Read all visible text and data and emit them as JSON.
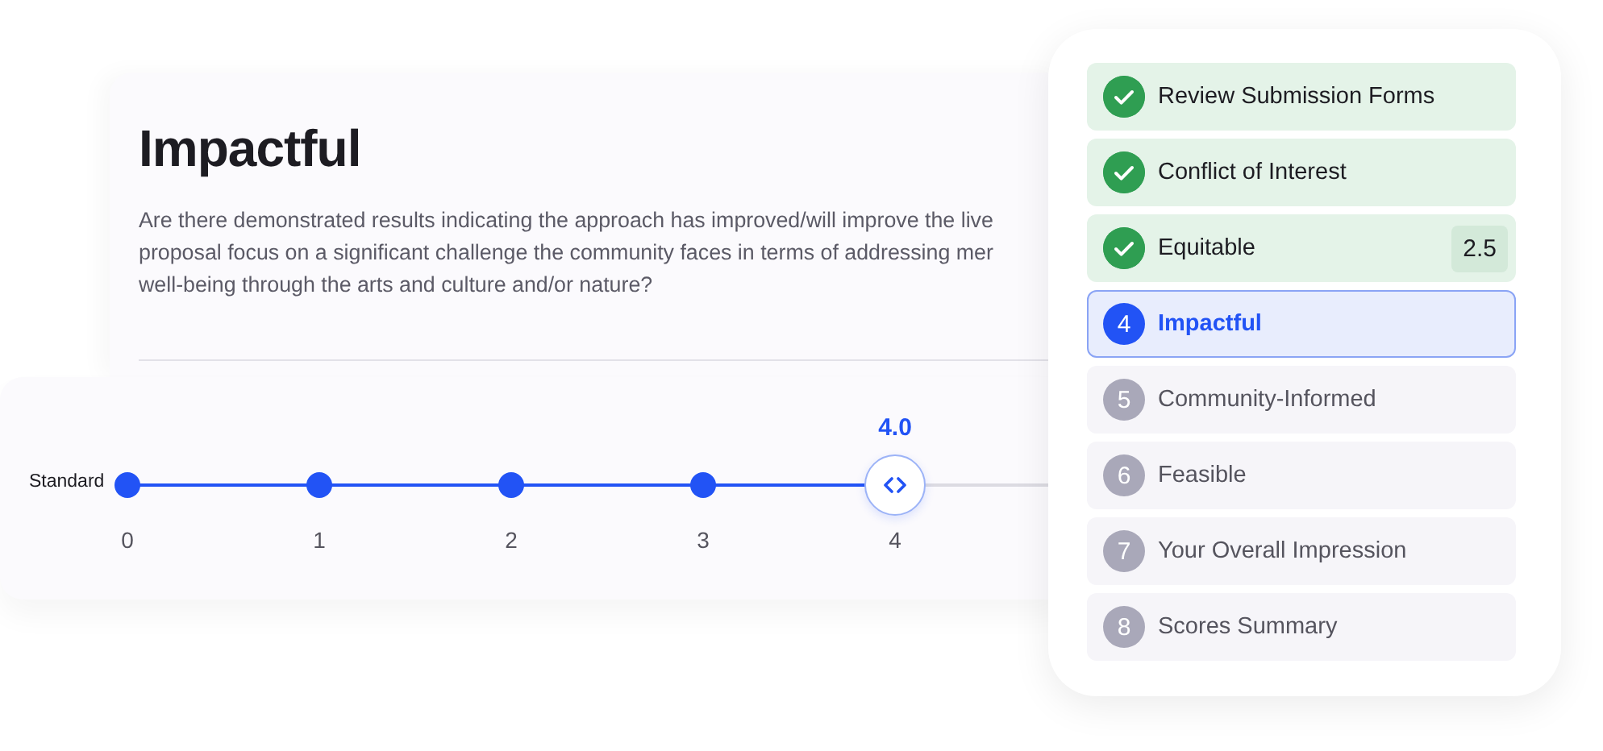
{
  "criterion": {
    "title": "Impactful",
    "description_lines": [
      "Are there demonstrated results indicating the approach has improved/will improve the live",
      "proposal focus on a significant challenge the community faces in terms of addressing mer",
      "well-being through the arts and culture and/or nature?"
    ]
  },
  "rating": {
    "label": "Standard",
    "value": "4.0",
    "level": 0.8,
    "ticks": [
      "0",
      "1",
      "2",
      "3",
      "4"
    ]
  },
  "steps": [
    {
      "label": "Review Submission Forms",
      "completed": true,
      "selected": false
    },
    {
      "label": "Conflict of Interest",
      "completed": true,
      "selected": false
    },
    {
      "label": "Equitable",
      "completed": true,
      "selected": false,
      "score": "2.5"
    },
    {
      "number": "4",
      "label": "Impactful",
      "completed": false,
      "selected": true
    },
    {
      "number": "5",
      "label": "Community-Informed",
      "completed": false,
      "selected": false
    },
    {
      "number": "6",
      "label": "Feasible",
      "completed": false,
      "selected": false
    },
    {
      "number": "7",
      "label": "Your Overall Impression",
      "completed": false,
      "selected": false
    },
    {
      "number": "8",
      "label": "Scores Summary",
      "completed": false,
      "selected": false
    }
  ]
}
